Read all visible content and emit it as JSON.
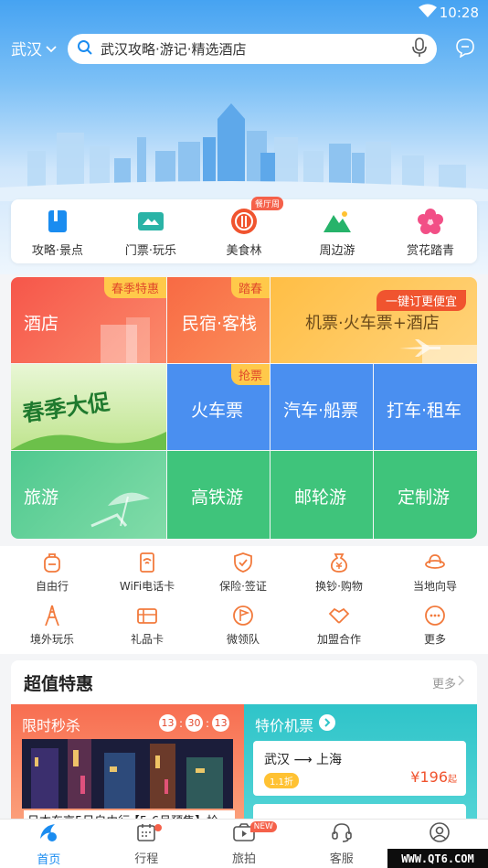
{
  "status_bar": {
    "time": "10:28"
  },
  "header": {
    "city": "武汉",
    "search_placeholder": "武汉攻略·游记·精选酒店"
  },
  "quick_nav": [
    {
      "label": "攻略·景点",
      "icon": "guide-book-icon",
      "color": "#1a8cf0"
    },
    {
      "label": "门票·玩乐",
      "icon": "ticket-icon",
      "color": "#2ab3a6"
    },
    {
      "label": "美食林",
      "icon": "food-icon",
      "color": "#f0542f",
      "badge": "餐厅周"
    },
    {
      "label": "周边游",
      "icon": "mountain-icon",
      "color": "#27b36a"
    },
    {
      "label": "赏花踏青",
      "icon": "flower-icon",
      "color": "#f24f86"
    }
  ],
  "grid": {
    "hotel": {
      "label": "酒店",
      "tag": "春季特惠"
    },
    "homestay": {
      "label": "民宿·客栈",
      "tag": "踏春"
    },
    "bundle": {
      "label": "机票·火车票+酒店",
      "tag": "一键订更便宜"
    },
    "promo": {
      "label": "春季大促"
    },
    "train": {
      "label": "火车票",
      "tag": "抢票"
    },
    "bus": {
      "label": "汽车·船票"
    },
    "taxi": {
      "label": "打车·租车"
    },
    "travel": {
      "label": "旅游"
    },
    "hsr": {
      "label": "高铁游"
    },
    "cruise": {
      "label": "邮轮游"
    },
    "custom": {
      "label": "定制游"
    }
  },
  "services": [
    {
      "label": "自由行",
      "icon": "backpack-icon"
    },
    {
      "label": "WiFi电话卡",
      "icon": "wifi-card-icon"
    },
    {
      "label": "保险·签证",
      "icon": "shield-icon"
    },
    {
      "label": "换钞·购物",
      "icon": "money-bag-icon"
    },
    {
      "label": "当地向导",
      "icon": "guide-hat-icon"
    },
    {
      "label": "境外玩乐",
      "icon": "eiffel-tower-icon"
    },
    {
      "label": "礼品卡",
      "icon": "gift-card-icon"
    },
    {
      "label": "微领队",
      "icon": "flag-icon"
    },
    {
      "label": "加盟合作",
      "icon": "handshake-icon"
    },
    {
      "label": "更多",
      "icon": "more-icon"
    }
  ],
  "deals": {
    "title": "超值特惠",
    "more": "更多",
    "flash_sale": {
      "title": "限时秒杀",
      "countdown": [
        "13",
        "30",
        "13"
      ],
      "caption": "日本东京5日自由行·【5-6月预售】抢"
    },
    "air": {
      "title": "特价机票",
      "from": "武汉",
      "to": "上海",
      "discount": "1.1折",
      "price": "¥196",
      "price_suffix": "起"
    }
  },
  "tabs": [
    {
      "label": "首页",
      "icon": "home-icon",
      "active": true
    },
    {
      "label": "行程",
      "icon": "calendar-icon"
    },
    {
      "label": "旅拍",
      "icon": "camera-icon",
      "badge": "NEW"
    },
    {
      "label": "客服",
      "icon": "headset-icon"
    },
    {
      "label": "我的",
      "icon": "user-icon"
    }
  ],
  "watermark": "WWW.QT6.COM"
}
